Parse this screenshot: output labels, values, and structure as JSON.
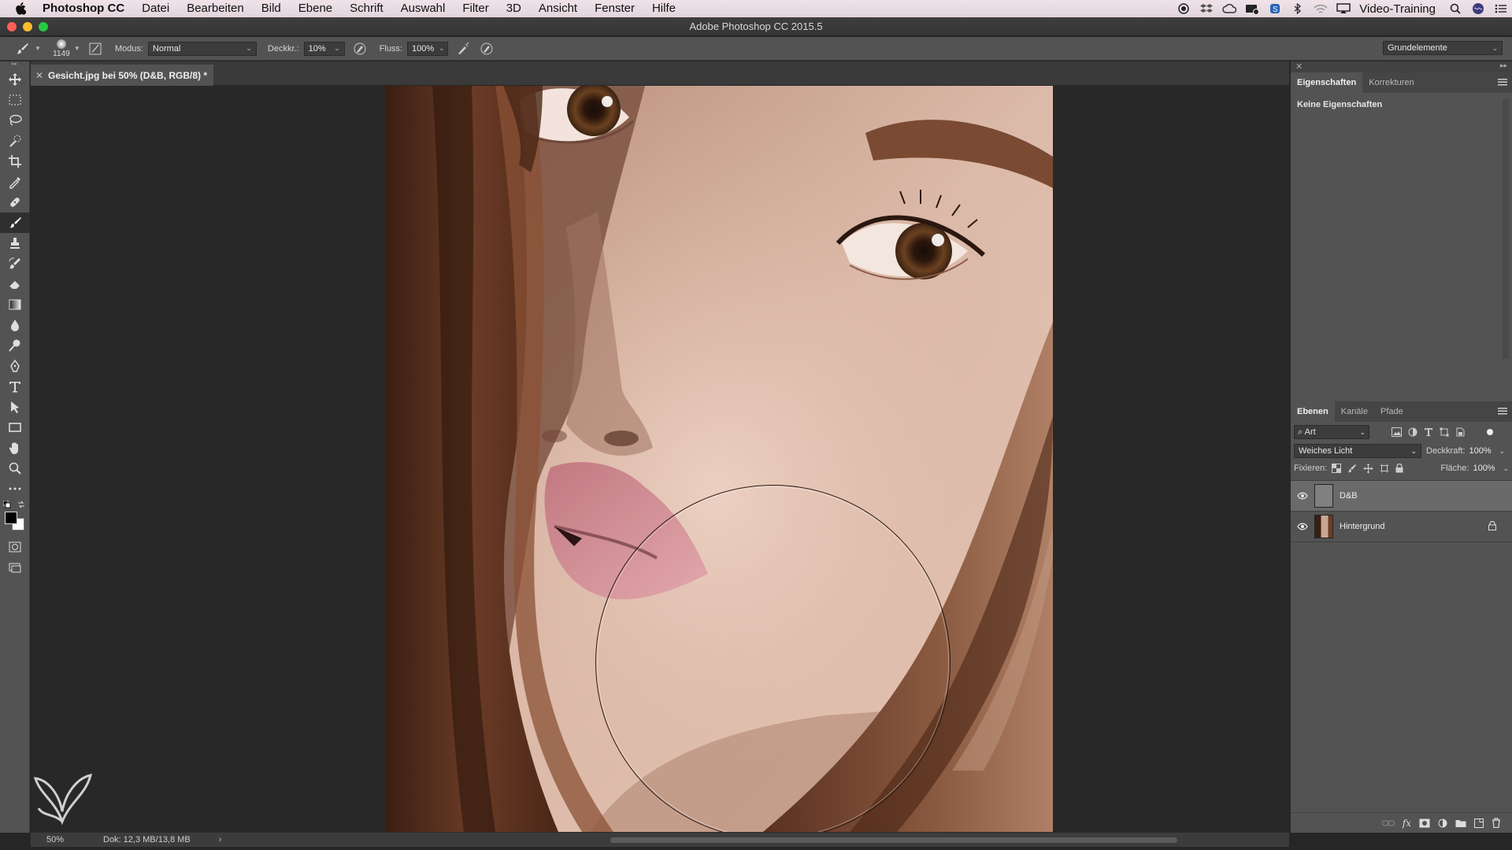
{
  "menubar": {
    "app_name": "Photoshop CC",
    "items": [
      "Datei",
      "Bearbeiten",
      "Bild",
      "Ebene",
      "Schrift",
      "Auswahl",
      "Filter",
      "3D",
      "Ansicht",
      "Fenster",
      "Hilfe"
    ],
    "user": "Video-Training"
  },
  "window": {
    "title": "Adobe Photoshop CC 2015.5"
  },
  "options": {
    "brush_size": "1149",
    "mode_label": "Modus:",
    "mode_value": "Normal",
    "opacity_label": "Deckkr.:",
    "opacity_value": "10%",
    "flow_label": "Fluss:",
    "flow_value": "100%",
    "workspace": "Grundelemente"
  },
  "document": {
    "tab_title": "Gesicht.jpg bei 50% (D&B, RGB/8) *"
  },
  "status": {
    "zoom": "50%",
    "doc_info": "Dok: 12,3 MB/13,8 MB",
    "arrow": "›"
  },
  "properties_panel": {
    "tabs": [
      "Eigenschaften",
      "Korrekturen"
    ],
    "empty_text": "Keine Eigenschaften"
  },
  "layers_panel": {
    "tabs": [
      "Ebenen",
      "Kanäle",
      "Pfade"
    ],
    "filter_value": "Art",
    "blend_mode": "Weiches Licht",
    "opacity_label": "Deckkraft:",
    "opacity_value": "100%",
    "lock_label": "Fixieren:",
    "fill_label": "Fläche:",
    "fill_value": "100%",
    "layers": [
      {
        "name": "D&B",
        "selected": true
      },
      {
        "name": "Hintergrund",
        "selected": false,
        "locked": true
      }
    ]
  },
  "colors": {
    "ui_dark": "#535353",
    "canvas_bg": "#282828",
    "accent_close": "#fc5f57"
  }
}
